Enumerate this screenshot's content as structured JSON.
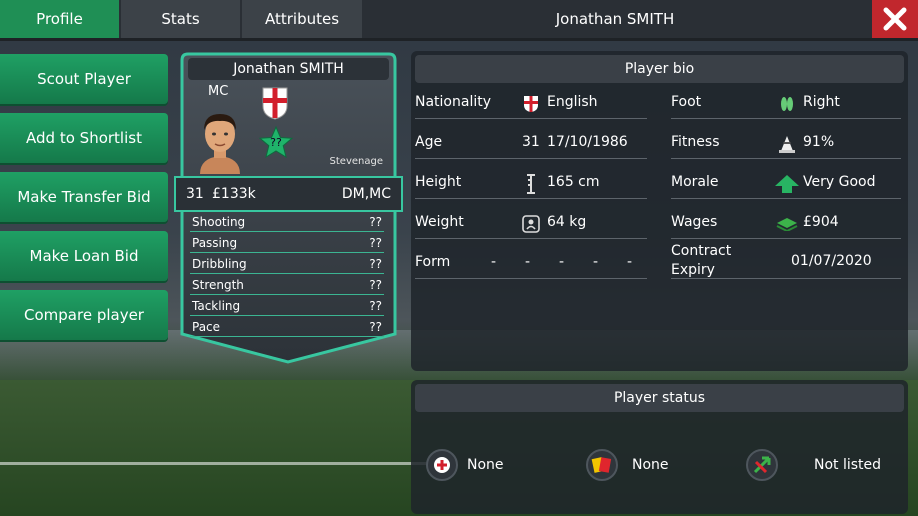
{
  "tabs": [
    {
      "label": "Profile"
    },
    {
      "label": "Stats"
    },
    {
      "label": "Attributes"
    }
  ],
  "page_title": "Jonathan SMITH",
  "actions": [
    {
      "label": "Scout Player"
    },
    {
      "label": "Add to Shortlist"
    },
    {
      "label": "Make Transfer Bid"
    },
    {
      "label": "Make Loan Bid"
    },
    {
      "label": "Compare player"
    }
  ],
  "card": {
    "name": "Jonathan SMITH",
    "position": "MC",
    "rating": "??",
    "club": "Stevenage",
    "age": "31",
    "value": "£133k",
    "positions": "DM,MC",
    "attributes": [
      {
        "name": "Shooting",
        "value": "??"
      },
      {
        "name": "Passing",
        "value": "??"
      },
      {
        "name": "Dribbling",
        "value": "??"
      },
      {
        "name": "Strength",
        "value": "??"
      },
      {
        "name": "Tackling",
        "value": "??"
      },
      {
        "name": "Pace",
        "value": "??"
      }
    ]
  },
  "bio": {
    "title": "Player bio",
    "nationality_label": "Nationality",
    "nationality": "English",
    "age_label": "Age",
    "age": "31",
    "dob": "17/10/1986",
    "height_label": "Height",
    "height": "165 cm",
    "weight_label": "Weight",
    "weight": "64 kg",
    "form_label": "Form",
    "form": [
      "-",
      "-",
      "-",
      "-",
      "-"
    ],
    "foot_label": "Foot",
    "foot": "Right",
    "fitness_label": "Fitness",
    "fitness": "91%",
    "morale_label": "Morale",
    "morale": "Very Good",
    "wages_label": "Wages",
    "wages": "£904",
    "contract_label_1": "Contract",
    "contract_label_2": "Expiry",
    "contract": "01/07/2020"
  },
  "status": {
    "title": "Player status",
    "injury": "None",
    "cards": "None",
    "transfer": "Not listed"
  },
  "colors": {
    "accent": "#1f8f55",
    "card_border": "#38c7a0",
    "close": "#c1272d"
  }
}
